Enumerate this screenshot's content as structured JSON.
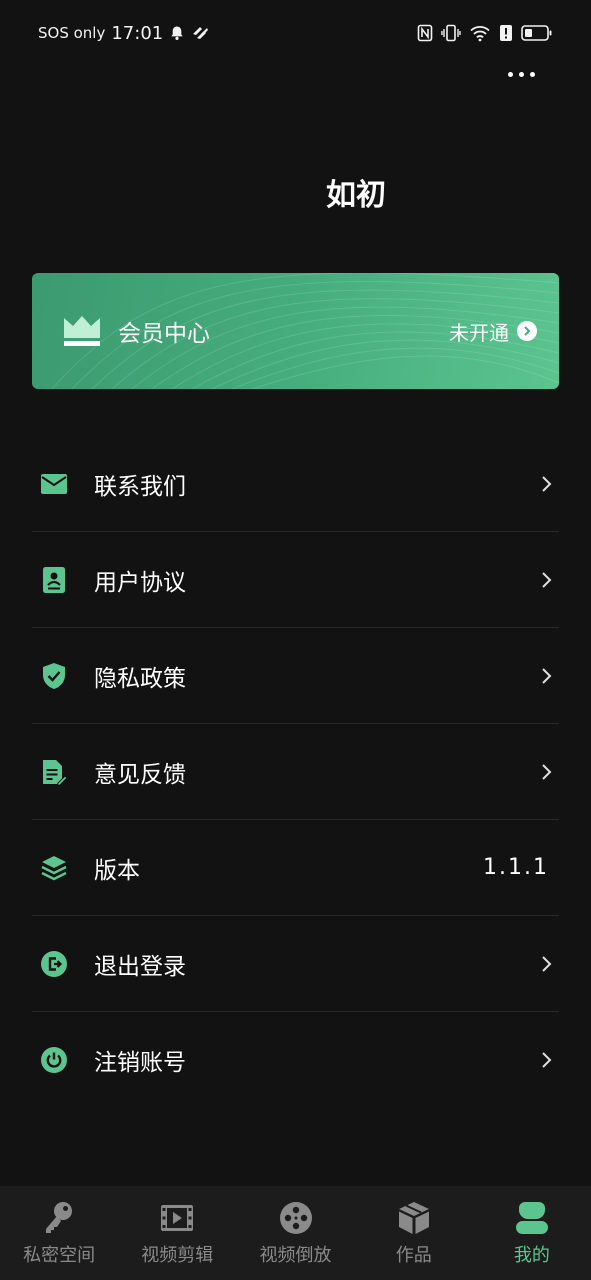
{
  "status_bar": {
    "carrier": "SOS only",
    "time": "17:01",
    "icons": [
      "bell-icon",
      "signal-heart-icon",
      "nfc-icon",
      "vibrate-icon",
      "wifi-icon",
      "alert-icon",
      "battery-icon"
    ]
  },
  "header": {
    "title": "如初",
    "more_icon": "more-horizontal-icon"
  },
  "vip_card": {
    "title": "会员中心",
    "status": "未开通",
    "icon": "crown-icon"
  },
  "menu": {
    "items": [
      {
        "label": "联系我们",
        "icon": "mail-icon"
      },
      {
        "label": "用户协议",
        "icon": "contract-icon"
      },
      {
        "label": "隐私政策",
        "icon": "shield-check-icon"
      },
      {
        "label": "意见反馈",
        "icon": "feedback-icon"
      },
      {
        "label": "版本",
        "icon": "layers-icon",
        "value": "1.1.1"
      },
      {
        "label": "退出登录",
        "icon": "logout-icon"
      },
      {
        "label": "注销账号",
        "icon": "power-icon"
      }
    ]
  },
  "bottom_nav": {
    "items": [
      {
        "label": "私密空间",
        "icon": "key-icon"
      },
      {
        "label": "视频剪辑",
        "icon": "film-icon"
      },
      {
        "label": "视频倒放",
        "icon": "reel-icon"
      },
      {
        "label": "作品",
        "icon": "box-icon"
      },
      {
        "label": "我的",
        "icon": "user-icon",
        "active": true
      }
    ]
  },
  "colors": {
    "background": "#121212",
    "accent": "#5bc48f",
    "nav_background": "#1c1c1c",
    "divider": "#2a2a2a"
  }
}
